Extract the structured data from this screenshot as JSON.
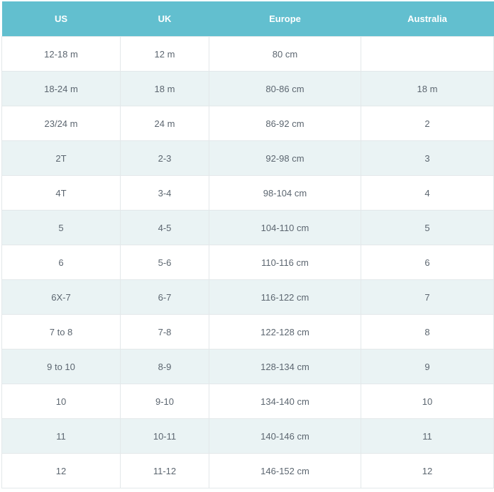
{
  "table": {
    "headers": [
      "US",
      "UK",
      "Europe",
      "Australia"
    ],
    "rows": [
      [
        "12-18 m",
        "12 m",
        "80 cm",
        ""
      ],
      [
        "18-24 m",
        "18 m",
        "80-86 cm",
        "18 m"
      ],
      [
        "23/24 m",
        "24 m",
        "86-92 cm",
        "2"
      ],
      [
        "2T",
        "2-3",
        "92-98 cm",
        "3"
      ],
      [
        "4T",
        "3-4",
        "98-104 cm",
        "4"
      ],
      [
        "5",
        "4-5",
        "104-110 cm",
        "5"
      ],
      [
        "6",
        "5-6",
        "110-116 cm",
        "6"
      ],
      [
        "6X-7",
        "6-7",
        "116-122 cm",
        "7"
      ],
      [
        "7 to 8",
        "7-8",
        "122-128 cm",
        "8"
      ],
      [
        "9 to 10",
        "8-9",
        "128-134 cm",
        "9"
      ],
      [
        "10",
        "9-10",
        "134-140 cm",
        "10"
      ],
      [
        "11",
        "10-11",
        "140-146 cm",
        "11"
      ],
      [
        "12",
        "11-12",
        "146-152 cm",
        "12"
      ]
    ]
  },
  "colors": {
    "header_bg": "#62bfcf",
    "header_text": "#ffffff",
    "stripe_bg": "#eaf3f4",
    "cell_text": "#5c6670"
  }
}
